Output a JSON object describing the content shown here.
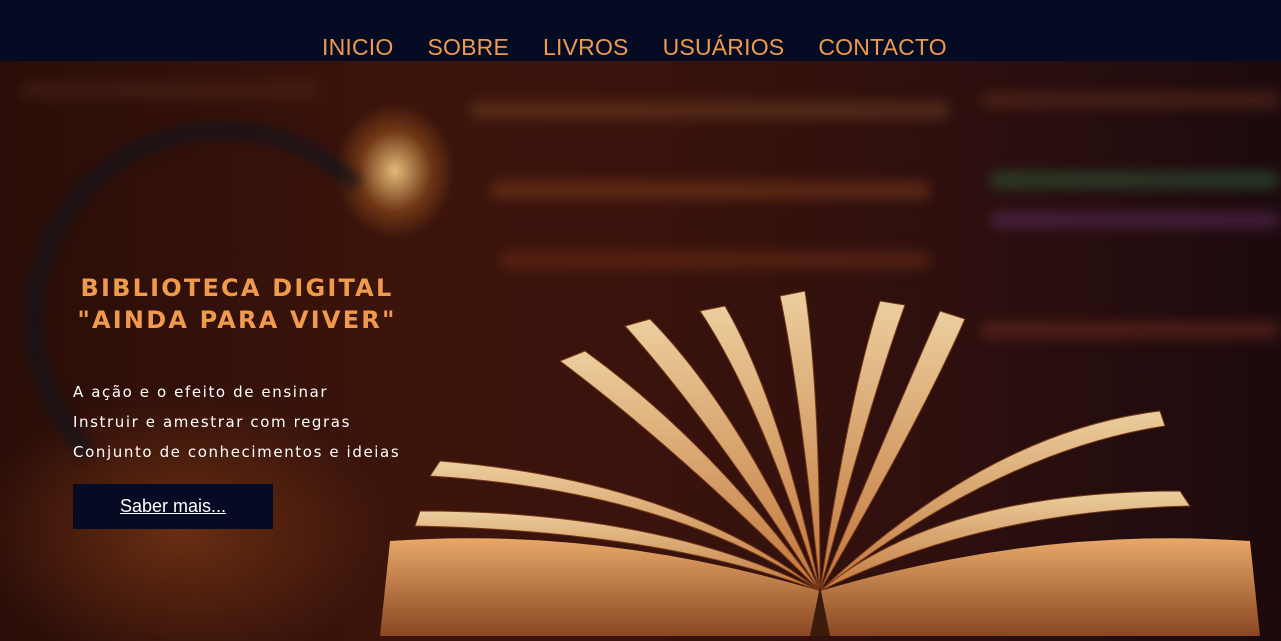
{
  "nav": {
    "items": [
      "INICIO",
      "SOBRE",
      "LIVROS",
      "USUÁRIOS",
      "CONTACTO"
    ]
  },
  "hero": {
    "title_line1": "BIBLIOTECA DIGITAL",
    "title_line2": "\"AINDA PARA VIVER\"",
    "lines": [
      "A ação e o efeito de ensinar",
      "Instruir e amestrar com regras",
      "Conjunto de conhecimentos e ideias"
    ],
    "button_label": "Saber mais..."
  },
  "colors": {
    "navbar_bg": "#050b23",
    "nav_text": "#ef9a4c",
    "title": "#ef9a4c",
    "button_bg": "#050b23",
    "button_text": "#ffffff"
  },
  "background_image": "open-book-library-photo"
}
